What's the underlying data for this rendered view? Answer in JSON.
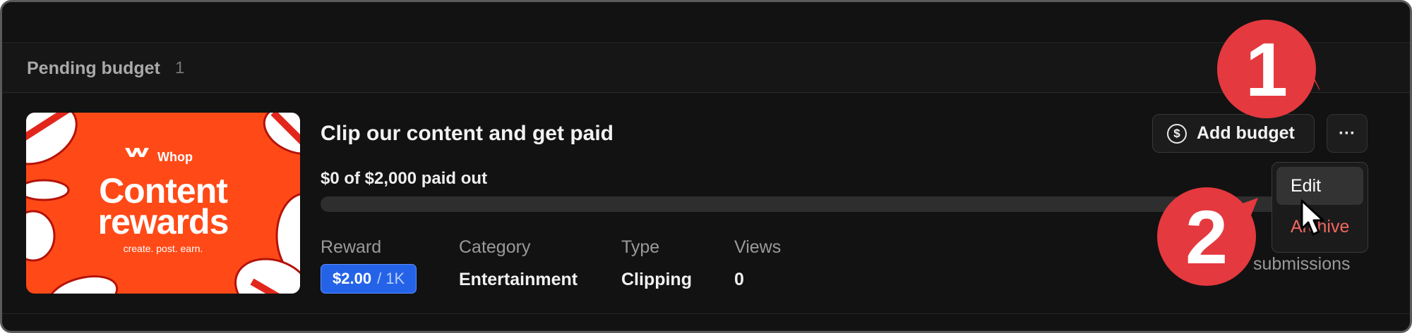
{
  "section": {
    "title": "Pending budget",
    "count": "1"
  },
  "thumbnail": {
    "brand": "Whop",
    "line1": "Content",
    "line2": "rewards",
    "tagline": "create. post. earn.",
    "background_color": "#ff4a17"
  },
  "campaign": {
    "title": "Clip our content and get paid",
    "paid_out_text": "$0 of $2,000 paid out",
    "paid_fraction": 0
  },
  "stats": {
    "reward_label": "Reward",
    "reward_amount": "$2.00",
    "reward_unit": "/ 1K",
    "category_label": "Category",
    "category_value": "Entertainment",
    "type_label": "Type",
    "type_value": "Clipping",
    "views_label": "Views",
    "views_value": "0",
    "submissions_label": "submissions"
  },
  "actions": {
    "add_budget_label": "Add budget",
    "add_budget_icon": "dollar-circle-icon",
    "more_label": "···"
  },
  "menu": {
    "items": [
      {
        "label": "Edit"
      },
      {
        "label": "Archive"
      }
    ]
  },
  "annotations": {
    "step1": "1",
    "step2": "2",
    "marker_color": "#e4393e"
  }
}
